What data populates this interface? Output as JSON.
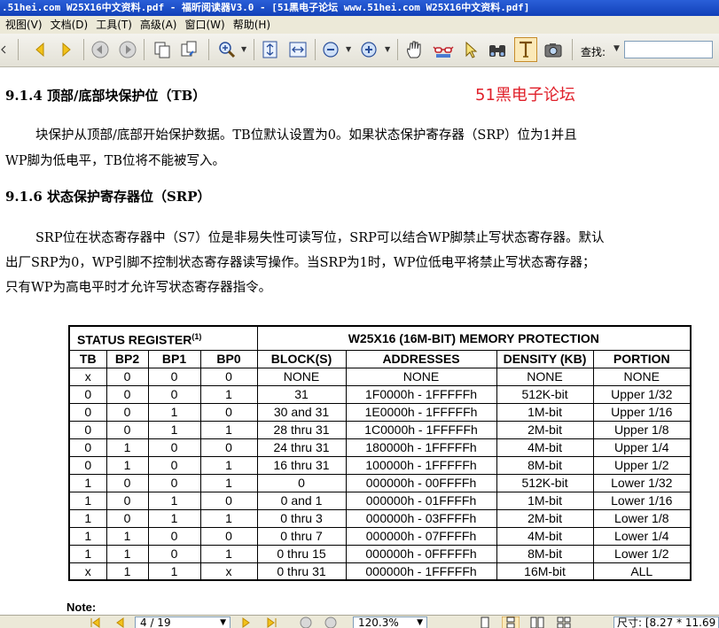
{
  "window": {
    "title": ".51hei.com W25X16中文资料.pdf - 福昕阅读器V3.0 - [51黑电子论坛 www.51hei.com W25X16中文资料.pdf]"
  },
  "menu": [
    {
      "label": "视图(V)"
    },
    {
      "label": "文档(D)"
    },
    {
      "label": "工具(T)"
    },
    {
      "label": "高级(A)"
    },
    {
      "label": "窗口(W)"
    },
    {
      "label": "帮助(H)"
    }
  ],
  "toolbar": {
    "find_label": "查找:",
    "find_value": ""
  },
  "document": {
    "watermark": "51黑电子论坛",
    "heading_tb": "9.1.4 顶部/底部块保护位（TB）",
    "para_tb_1": "块保护从顶部/底部开始保护数据。TB位默认设置为0。如果状态保护寄存器（SRP）位为1并且",
    "para_tb_2": "WP脚为低电平，TB位将不能被写入。",
    "heading_srp": "9.1.6 状态保护寄存器位（SRP）",
    "para_srp_1": "SRP位在状态寄存器中（S7）位是非易失性可读写位，SRP可以结合WP脚禁止写状态寄存器。默认",
    "para_srp_2": "出厂SRP为0，WP引脚不控制状态寄存器读写操作。当SRP为1时，WP位低电平将禁止写状态寄存器；",
    "para_srp_3": "只有WP为高电平时才允许写状态寄存器指令。",
    "note": "Note:"
  },
  "table": {
    "header_left": "STATUS REGISTER",
    "header_left_sup": "(1)",
    "header_right": "W25X16 (16M-BIT) MEMORY PROTECTION",
    "columns": [
      "TB",
      "BP2",
      "BP1",
      "BP0",
      "BLOCK(S)",
      "ADDRESSES",
      "DENSITY (KB)",
      "PORTION"
    ],
    "rows": [
      [
        "x",
        "0",
        "0",
        "0",
        "NONE",
        "NONE",
        "NONE",
        "NONE"
      ],
      [
        "0",
        "0",
        "0",
        "1",
        "31",
        "1F0000h - 1FFFFFh",
        "512K-bit",
        "Upper 1/32"
      ],
      [
        "0",
        "0",
        "1",
        "0",
        "30 and 31",
        "1E0000h - 1FFFFFh",
        "1M-bit",
        "Upper 1/16"
      ],
      [
        "0",
        "0",
        "1",
        "1",
        "28 thru 31",
        "1C0000h - 1FFFFFh",
        "2M-bit",
        "Upper 1/8"
      ],
      [
        "0",
        "1",
        "0",
        "0",
        "24 thru 31",
        "180000h - 1FFFFFh",
        "4M-bit",
        "Upper 1/4"
      ],
      [
        "0",
        "1",
        "0",
        "1",
        "16 thru 31",
        "100000h - 1FFFFFh",
        "8M-bit",
        "Upper 1/2"
      ],
      [
        "1",
        "0",
        "0",
        "1",
        "0",
        "000000h - 00FFFFh",
        "512K-bit",
        "Lower 1/32"
      ],
      [
        "1",
        "0",
        "1",
        "0",
        "0 and 1",
        "000000h - 01FFFFh",
        "1M-bit",
        "Lower 1/16"
      ],
      [
        "1",
        "0",
        "1",
        "1",
        "0 thru 3",
        "000000h - 03FFFFh",
        "2M-bit",
        "Lower 1/8"
      ],
      [
        "1",
        "1",
        "0",
        "0",
        "0 thru 7",
        "000000h - 07FFFFh",
        "4M-bit",
        "Lower 1/4"
      ],
      [
        "1",
        "1",
        "0",
        "1",
        "0 thru 15",
        "000000h - 0FFFFFh",
        "8M-bit",
        "Lower 1/2"
      ],
      [
        "x",
        "1",
        "1",
        "x",
        "0 thru 31",
        "000000h - 1FFFFFh",
        "16M-bit",
        "ALL"
      ]
    ]
  },
  "statusbar": {
    "page": "4 / 19",
    "zoom": "120.3%",
    "size": "尺寸: [8.27 * 11.69 英寸]"
  },
  "colors": {
    "titlebar": "#1d4fc8",
    "watermark": "#e0202a",
    "toolbar_bg": "#ece9d8"
  },
  "icons": [
    "left-scroll-icon",
    "prev-page-icon",
    "next-page-icon",
    "back-icon",
    "forward-icon",
    "copy-icon",
    "paste-icon",
    "zoom-in-tool-icon",
    "fit-page-icon",
    "fit-width-icon",
    "zoom-out-icon",
    "zoom-plus-icon",
    "hand-tool-icon",
    "reading-icon",
    "select-arrow-icon",
    "binoculars-icon",
    "text-select-icon",
    "snapshot-icon"
  ]
}
